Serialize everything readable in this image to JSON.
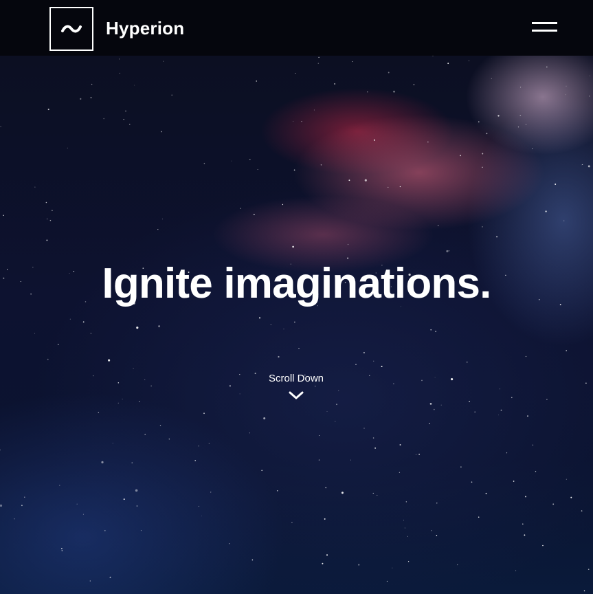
{
  "header": {
    "brand_name": "Hyperion",
    "logo_icon": "tilde-wave-icon",
    "menu_icon": "hamburger-menu-icon"
  },
  "hero": {
    "headline": "Ignite imaginations.",
    "scroll_label": "Scroll Down",
    "scroll_icon": "chevron-down-icon",
    "background": "space-nebula-image"
  },
  "colors": {
    "header_bg": "#05060d",
    "text": "#ffffff",
    "nebula_pink": "#e86882",
    "space_blue": "#0d1230"
  }
}
